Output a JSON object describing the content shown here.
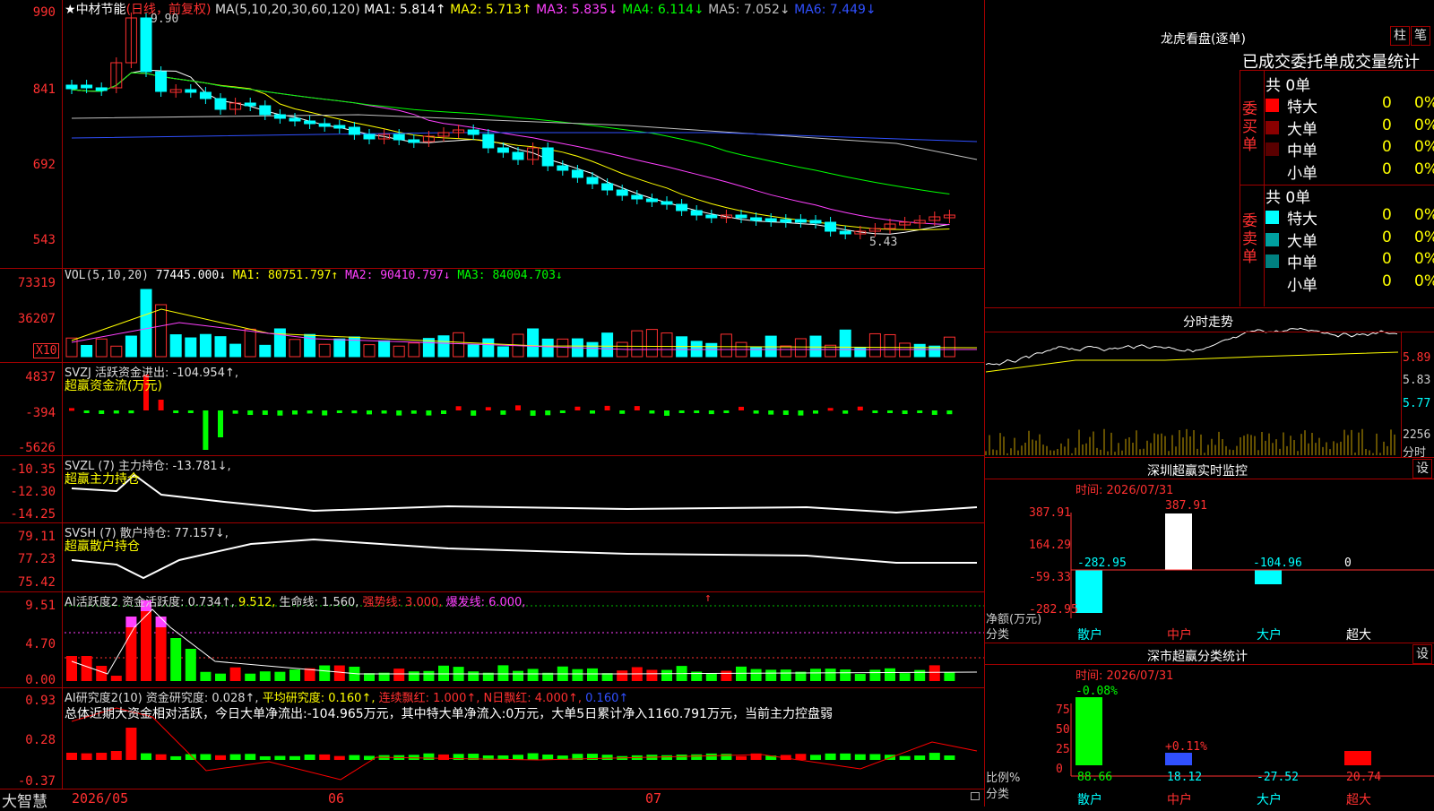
{
  "stock": {
    "name": "中材节能",
    "period": "(日线，前复权)",
    "star": "★"
  },
  "ma_header": {
    "label": "MA(5,10,20,30,60,120)",
    "ma1": "MA1: 5.814↑",
    "ma2": "MA2: 5.713↑",
    "ma3": "MA3: 5.835↓",
    "ma4": "MA4: 6.114↓",
    "ma5": "MA5: 7.052↓",
    "ma6": "MA6: 7.449↓"
  },
  "price_axis": [
    "990",
    "841",
    "692",
    "543"
  ],
  "price_marks": {
    "high": "9.90",
    "low": "5.43"
  },
  "vol": {
    "header": "VOL(5,10,20)",
    "value": "77445.000↓",
    "ma1": "MA1: 80751.797↑",
    "ma2": "MA2: 90410.797↓",
    "ma3": "MA3: 84004.703↓",
    "axis": [
      "73319",
      "36207"
    ],
    "unit": "X10"
  },
  "svzj": {
    "header": "SVZJ  活跃资金进出: -104.954↑,",
    "sub": "超赢资金流(万元)",
    "axis": [
      "4837",
      "-394",
      "-5626"
    ]
  },
  "svzl": {
    "header": "SVZL (7) 主力持仓: -13.781↓,",
    "sub": "超赢主力持仓",
    "axis": [
      "-10.35",
      "-12.30",
      "-14.25"
    ]
  },
  "svsh": {
    "header": "SVSH (7) 散户持仓: 77.157↓,",
    "sub": "超赢散户持仓",
    "axis": [
      "79.11",
      "77.23",
      "75.42"
    ]
  },
  "ai1": {
    "header_a": "AI活跃度2 资金活跃度: 0.734↑,",
    "header_b": "9.512,",
    "header_c": "生命线: 1.560,",
    "header_d": "强势线: 3.000,",
    "header_e": "爆发线: 6.000,",
    "arrow": "↑",
    "axis": [
      "9.51",
      "4.70",
      "0.00"
    ]
  },
  "ai2": {
    "header_a": "AI研究度2(10) 资金研究度: 0.028↑,",
    "header_b": "平均研究度: 0.160↑,",
    "header_c": "连续飘红: 1.000↑,",
    "header_d": "N日飘红: 4.000↑,",
    "header_e": "0.160↑",
    "summary": "总体近期大资金相对活跃，今日大单净流出:-104.965万元，其中特大单净流入:0万元，大单5日累计净入1160.791万元，当前主力控盘弱",
    "axis": [
      "0.93",
      "0.28",
      "-0.37"
    ]
  },
  "xaxis": {
    "brand": "大智慧",
    "d1": "2026/05",
    "d2": "06",
    "d3": "07"
  },
  "lhkp": {
    "title": "龙虎看盘(逐单)",
    "btn1": "柱",
    "btn2": "笔",
    "sub": "已成交委托单成交量统计",
    "buy_label": "委买单",
    "sell_label": "委卖单",
    "buy_total": "共 0单",
    "sell_total": "共 0单",
    "buy_rows": [
      {
        "name": "特大",
        "val": "0",
        "pct": "0%",
        "color": "#ff0000"
      },
      {
        "name": "大单",
        "val": "0",
        "pct": "0%",
        "color": "#8a0000"
      },
      {
        "name": "中单",
        "val": "0",
        "pct": "0%",
        "color": "#5a0000"
      },
      {
        "name": "小单",
        "val": "0",
        "pct": "0%",
        "color": ""
      }
    ],
    "sell_rows": [
      {
        "name": "特大",
        "val": "0",
        "pct": "0%",
        "color": "#00ffff"
      },
      {
        "name": "大单",
        "val": "0",
        "pct": "0%",
        "color": "#00a0a0"
      },
      {
        "name": "中单",
        "val": "0",
        "pct": "0%",
        "color": "#008080"
      },
      {
        "name": "小单",
        "val": "0",
        "pct": "0%",
        "color": ""
      }
    ]
  },
  "fenshi": {
    "title": "分时走势",
    "axis": [
      "5.89",
      "5.83",
      "5.77"
    ],
    "vol": "2256",
    "vol_label": "分时"
  },
  "sz_monitor": {
    "title": "深圳超赢实时监控",
    "btn": "设",
    "time": "时间: 2026/07/31",
    "axis": [
      "387.91",
      "164.29",
      "-59.33",
      "-282.95"
    ],
    "unit": "净额(万元)",
    "cat_label": "分类",
    "values": [
      "-282.95",
      "387.91",
      "-104.96",
      "0"
    ],
    "cats": [
      "散户",
      "中户",
      "大户",
      "超大"
    ]
  },
  "sz_class": {
    "title": "深市超赢分类统计",
    "btn": "设",
    "time": "时间: 2026/07/31",
    "axis": [
      "75",
      "50",
      "25",
      "0"
    ],
    "unit": "比例%",
    "cat_label": "分类",
    "top": [
      "-0.08%",
      "+0.11%"
    ],
    "values": [
      "88.66",
      "18.12",
      "-27.52",
      "20.74"
    ],
    "cats": [
      "散户",
      "中户",
      "大户",
      "超大"
    ]
  }
}
